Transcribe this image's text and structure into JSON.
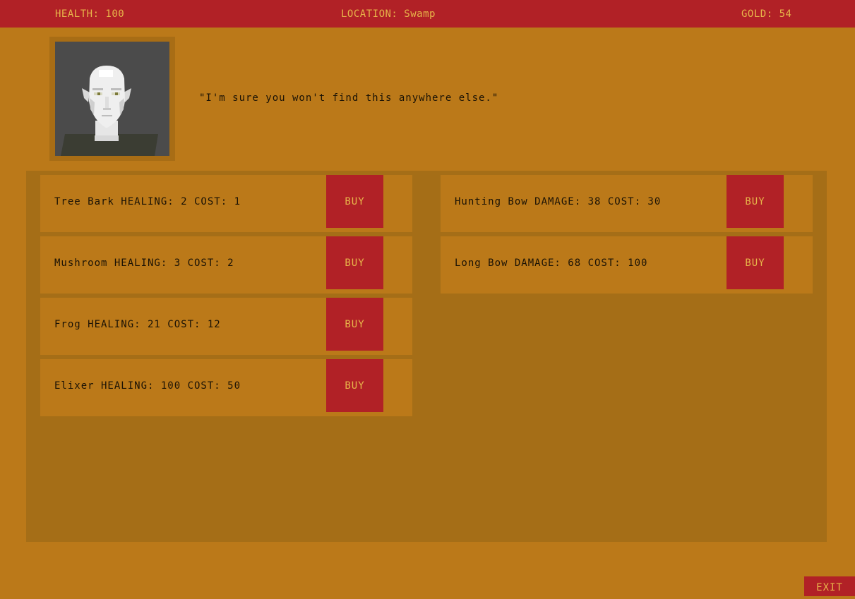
{
  "hud": {
    "health": "HEALTH: 100",
    "location": "LOCATION: Swamp",
    "gold": "GOLD: 54"
  },
  "merchant": {
    "dialogue": "\"I'm sure you won't find this anywhere else.\""
  },
  "shop": {
    "healing_items": [
      {
        "text": "Tree Bark  HEALING: 2 COST: 1",
        "button": "BUY"
      },
      {
        "text": "Mushroom  HEALING: 3 COST: 2",
        "button": "BUY"
      },
      {
        "text": "Frog  HEALING: 21 COST: 12",
        "button": "BUY"
      },
      {
        "text": "Elixer  HEALING: 100 COST: 50",
        "button": "BUY"
      }
    ],
    "weapon_items": [
      {
        "text": "Hunting Bow  DAMAGE: 38 COST: 30",
        "button": "BUY"
      },
      {
        "text": "Long Bow  DAMAGE: 68 COST: 100",
        "button": "BUY"
      }
    ]
  },
  "exit_label": "EXIT",
  "colors": {
    "background": "#bb7919",
    "panel": "#a56e17",
    "accent_red": "#b12126",
    "accent_text": "#e7b54a",
    "text_dark": "#1a1205"
  }
}
